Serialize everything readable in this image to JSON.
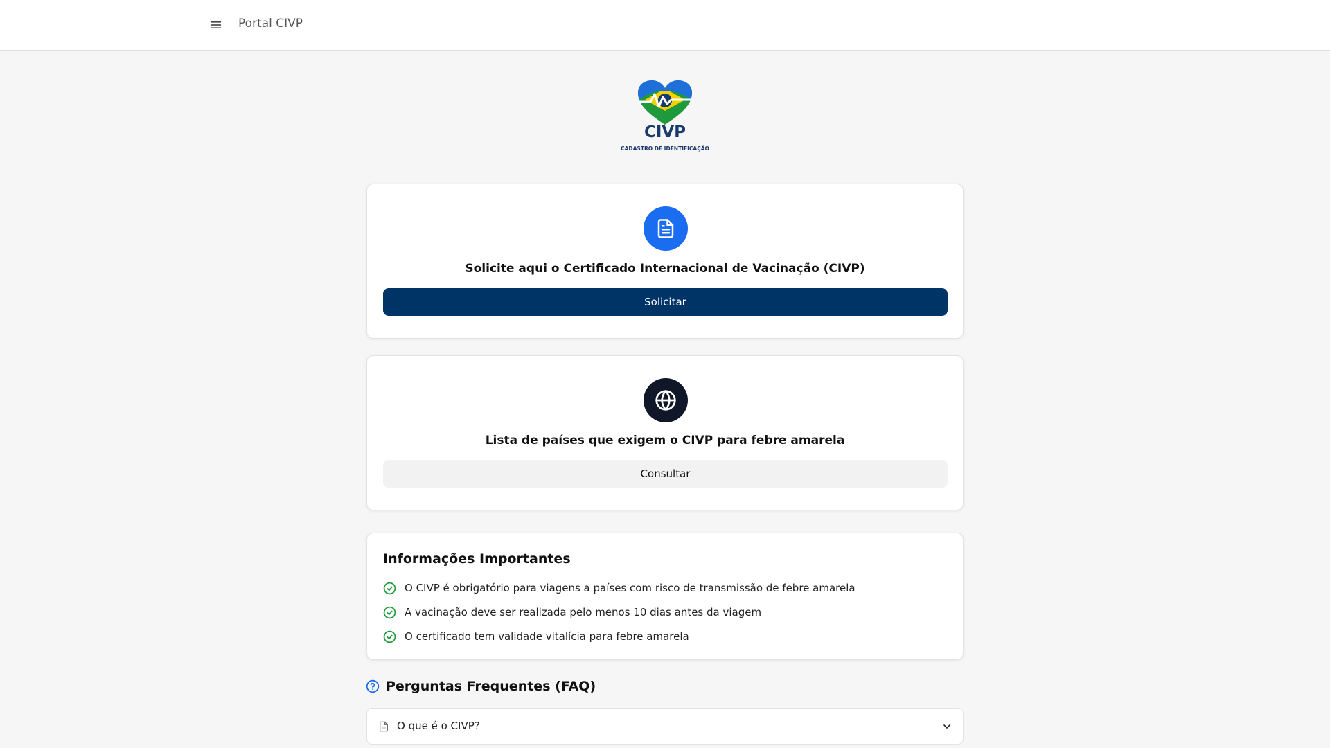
{
  "header": {
    "menu_icon": "menu-icon",
    "brand": "Portal CIVP"
  },
  "logo": {
    "name": "CIVP",
    "subtitle": "CADASTRO DE IDENTIFICAÇÃO",
    "colors": {
      "blue": "#1a3a6b",
      "green": "#1e9a3c",
      "yellow": "#f5d000",
      "sky": "#1e6fd9"
    }
  },
  "cards": [
    {
      "icon": "document-icon",
      "icon_bg": "#1a6cf0",
      "title": "Solicite aqui o Certificado Internacional de Vacinação (CIVP)",
      "button": "Solicitar",
      "button_color": "#003366"
    },
    {
      "icon": "globe-icon",
      "icon_bg": "#0f1729",
      "title": "Lista de países que exigem o CIVP para febre amarela",
      "button": "Consultar",
      "button_color": "#f2f2f2"
    }
  ],
  "info": {
    "title": "Informações Importantes",
    "check_color": "#1e9a3c",
    "items": [
      "O CIVP é obrigatório para viagens a países com risco de transmissão de febre amarela",
      "A vacinação deve ser realizada pelo menos 10 dias antes da viagem",
      "O certificado tem validade vitalícia para febre amarela"
    ]
  },
  "faq": {
    "icon": "help-circle-icon",
    "title": "Perguntas Frequentes (FAQ)",
    "items": [
      {
        "question": "O que é o CIVP?",
        "icon": "document-icon",
        "toggle_icon": "chevron-down-icon"
      }
    ]
  }
}
